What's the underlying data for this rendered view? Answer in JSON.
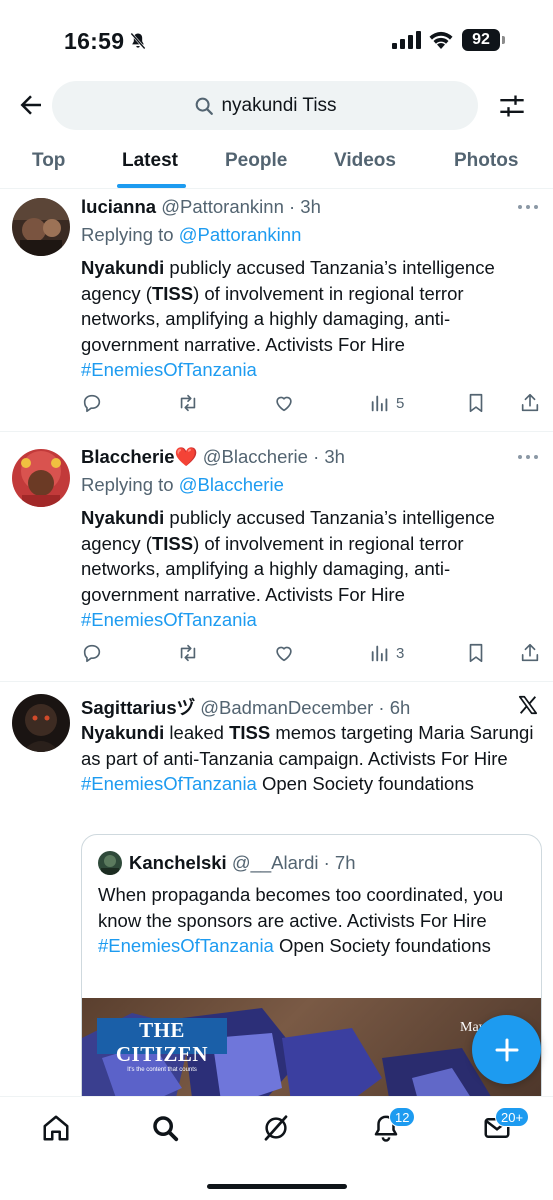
{
  "status_bar": {
    "time": "16:59",
    "battery": "92"
  },
  "search": {
    "query": "nyakundi Tiss"
  },
  "tabs": [
    "Top",
    "Latest",
    "People",
    "Videos",
    "Photos"
  ],
  "active_tab": "Latest",
  "tweets": [
    {
      "name": "lucianna",
      "handle": "@Pattorankinn",
      "time": "· 3h",
      "reply_prefix": "Replying to",
      "reply_to": "@Pattorankinn",
      "text_parts": {
        "b1": "Nyakundi",
        "t1": " publicly accused Tanzania’s intelligence agency (",
        "b2": "TISS",
        "t2": ") of involvement in regional terror networks, amplifying a highly damaging, anti-government narrative. Activists For Hire ",
        "hashtag": "#EnemiesOfTanzania"
      },
      "views": "5"
    },
    {
      "name": "Blaccherie❤️",
      "handle": "@Blaccherie",
      "time": "· 3h",
      "reply_prefix": "Replying to",
      "reply_to": "@Blaccherie",
      "text_parts": {
        "b1": "Nyakundi",
        "t1": " publicly accused Tanzania’s intelligence agency (",
        "b2": "TISS",
        "t2": ") of involvement in regional terror networks, amplifying a highly damaging, anti-government narrative. Activists For Hire ",
        "hashtag": "#EnemiesOfTanzania"
      },
      "views": "3"
    },
    {
      "name": "Sagittariusヅ",
      "handle": "@BadmanDecember",
      "time": "· 6h",
      "text_parts": {
        "b1": "Nyakundi",
        "t1": " leaked ",
        "b2": "TISS",
        "t2": " memos targeting Maria Sarungi as part of anti-Tanzania campaign. Activists For Hire ",
        "hashtag": "#EnemiesOfTanzania",
        "t3": " Open Society foundations"
      },
      "quote": {
        "name": "Kanchelski",
        "handle": "@__Alardi",
        "time": "· 7h",
        "text_before": "When propaganda becomes too coordinated, you know the sponsors are active. Activists For Hire ",
        "hashtag": "#EnemiesOfTanzania",
        "text_after": " Open Society foundations",
        "image_logo": "THE CITIZEN",
        "image_logo_tag": "It's the content that counts",
        "image_date": "May"
      }
    }
  ],
  "bottom_nav": {
    "notifications_badge": "12",
    "messages_badge": "20+"
  },
  "colors": {
    "accent": "#1d9bf0",
    "text": "#0f1419",
    "muted": "#536471"
  }
}
